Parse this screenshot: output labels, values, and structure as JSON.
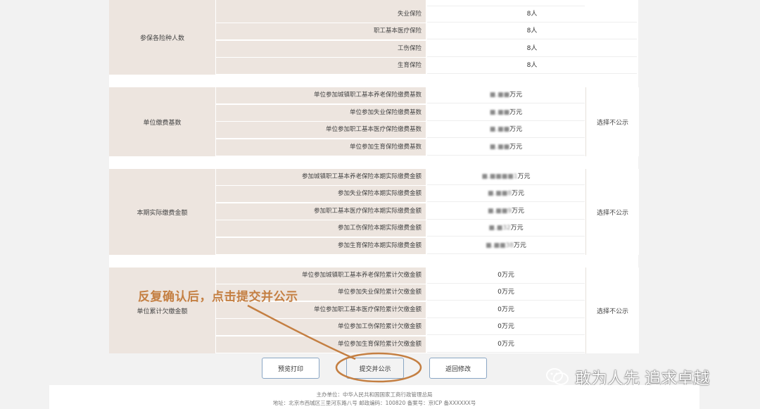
{
  "insured_section": {
    "group_label": "参保各险种人数",
    "rows": [
      {
        "label": "失业保险",
        "value": "8人"
      },
      {
        "label": "职工基本医疗保险",
        "value": "8人"
      },
      {
        "label": "工伤保险",
        "value": "8人"
      },
      {
        "label": "生育保险",
        "value": "8人"
      }
    ]
  },
  "base_section": {
    "group_label": "单位缴费基数",
    "side_label": "选择不公示",
    "rows": [
      {
        "label": "单位参加城镇职工基本养老保险缴费基数",
        "value_mask": "■.■■",
        "unit": "万元"
      },
      {
        "label": "单位参加失业保险缴费基数",
        "value_mask": "■.■■",
        "unit": "万元"
      },
      {
        "label": "单位参加职工基本医疗保险缴费基数",
        "value_mask": "■.■■",
        "unit": "万元"
      },
      {
        "label": "单位参加生育保险缴费基数",
        "value_mask": "■.■■",
        "unit": "万元"
      }
    ]
  },
  "paid_section": {
    "group_label": "本期实际缴费金额",
    "side_label": "选择不公示",
    "rows": [
      {
        "label": "参加城镇职工基本养老保险本期实际缴费金额",
        "value_mask": "■.■■■■1",
        "unit": "万元"
      },
      {
        "label": "参加失业保险本期实际缴费金额",
        "value_mask": "■.■■8",
        "unit": "万元"
      },
      {
        "label": "参加职工基本医疗保险本期实际缴费金额",
        "value_mask": "■.■■9",
        "unit": "万元"
      },
      {
        "label": "参加工伤保险本期实际缴费金额",
        "value_mask": "■.■32",
        "unit": "万元"
      },
      {
        "label": "参加生育保险本期实际缴费金额",
        "value_mask": "■.■■38",
        "unit": "万元"
      }
    ]
  },
  "arrears_section": {
    "group_label": "单位累计欠缴金额",
    "side_label": "选择不公示",
    "rows": [
      {
        "label": "单位参加城镇职工基本养老保险累计欠缴金额",
        "value": "0万元"
      },
      {
        "label": "单位参加失业保险累计欠缴金额",
        "value": "0万元"
      },
      {
        "label": "单位参加职工基本医疗保险累计欠缴金额",
        "value": "0万元"
      },
      {
        "label": "单位参加工伤保险累计欠缴金额",
        "value": "0万元"
      },
      {
        "label": "单位参加生育保险累计欠缴金额",
        "value": "0万元"
      }
    ]
  },
  "buttons": {
    "preview_print": "预览打印",
    "submit_publish": "提交并公示",
    "back_edit": "返回修改"
  },
  "annotation": "反复确认后，点击提交并公示",
  "watermark": "敢为人先 追求卓越",
  "footer": {
    "line1": "主办单位：中华人民共和国国家工商行政管理总局",
    "line2": "地址：北京市西城区三里河东路八号 邮政编码：100820 备案号：京ICP 备XXXXXX号"
  },
  "colors": {
    "label_bg": "#ede5df",
    "annotation": "#c47f42",
    "button_border": "#8aa6c4"
  }
}
